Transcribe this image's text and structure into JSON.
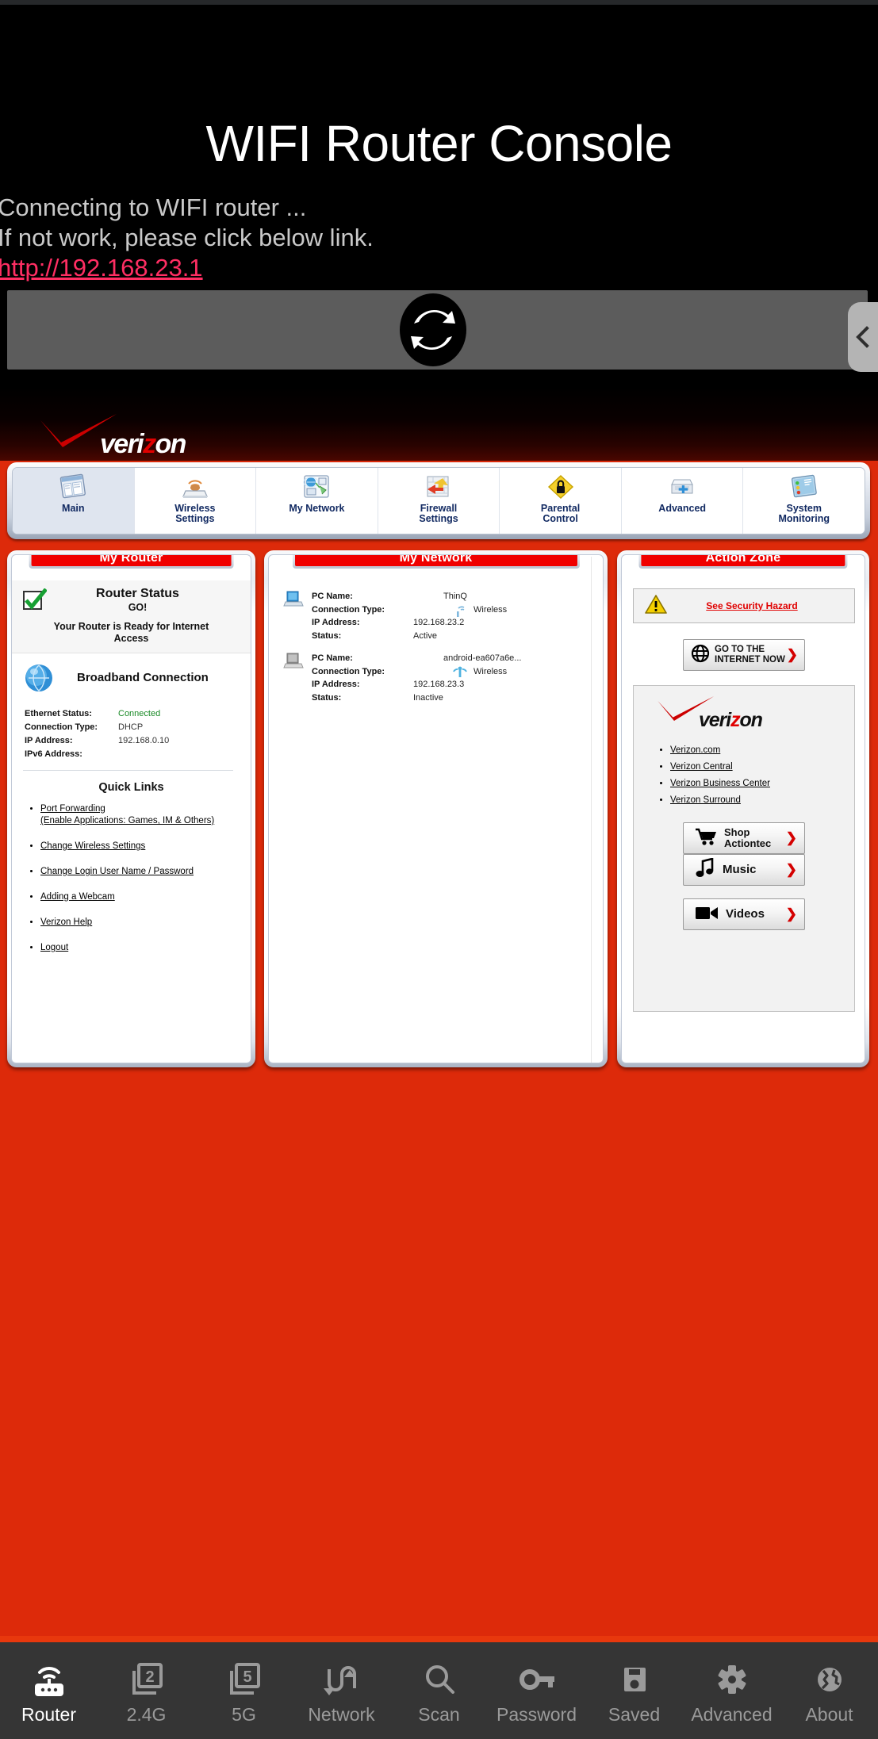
{
  "app": {
    "title": "WIFI Router Console",
    "connecting_text": "Connecting to WIFI router ...",
    "fallback_text": " If not work, please click below link.",
    "fallback_link": "http://192.168.23.1",
    "link_color": "#ff2e63",
    "accent_red": "#e8380d",
    "page_red": "#dd2a0a"
  },
  "refresh_bar": {
    "icon": "refresh-icon",
    "side_tab_icon": "chevron-left-icon"
  },
  "router_page": {
    "brand": {
      "word_ver": "veri",
      "word_z": "z",
      "word_on": "on"
    },
    "nav": [
      {
        "label_line1": "Main",
        "label_line2": "",
        "icon": "main-window-icon",
        "active": true
      },
      {
        "label_line1": "Wireless",
        "label_line2": "Settings",
        "icon": "wireless-router-icon",
        "active": false
      },
      {
        "label_line1": "My Network",
        "label_line2": "",
        "icon": "my-network-icon",
        "active": false
      },
      {
        "label_line1": "Firewall",
        "label_line2": "Settings",
        "icon": "firewall-icon",
        "active": false
      },
      {
        "label_line1": "Parental",
        "label_line2": "Control",
        "icon": "parental-lock-icon",
        "active": false
      },
      {
        "label_line1": "Advanced",
        "label_line2": "",
        "icon": "advanced-box-icon",
        "active": false
      },
      {
        "label_line1": "System",
        "label_line2": "Monitoring",
        "icon": "system-monitor-icon",
        "active": false
      }
    ],
    "my_router": {
      "title": "My Router",
      "status_heading": "Router Status",
      "status_go": "GO!",
      "status_ready": "Your Router is Ready for Internet Access",
      "broadband_heading": "Broadband Connection",
      "fields": [
        {
          "key": "Ethernet Status:",
          "value": "Connected",
          "ok": true
        },
        {
          "key": "Connection Type:",
          "value": "DHCP",
          "ok": false
        },
        {
          "key": "IP Address:",
          "value": "192.168.0.10",
          "ok": false
        },
        {
          "key": "IPv6 Address:",
          "value": "",
          "ok": false
        }
      ],
      "quick_links_heading": "Quick Links",
      "quick_links": [
        "Port Forwarding (Enable Applications: Games, IM & Others)",
        "Change Wireless Settings",
        "Change Login User Name / Password",
        "Adding a Webcam",
        "Verizon Help",
        "Logout"
      ]
    },
    "my_network": {
      "title": "My Network",
      "devices": [
        {
          "icon": "computer-active-icon",
          "pc_name_key": "PC Name:",
          "pc_name": "ThinQ",
          "conn_key": "Connection Type:",
          "conn": "Wireless",
          "ip_key": "IP Address:",
          "ip": "192.168.23.2",
          "status_key": "Status:",
          "status": "Active"
        },
        {
          "icon": "computer-inactive-icon",
          "pc_name_key": "PC Name:",
          "pc_name": "android-ea607a6e...",
          "conn_key": "Connection Type:",
          "conn": "Wireless",
          "ip_key": "IP Address:",
          "ip": "192.168.23.3",
          "status_key": "Status:",
          "status": "Inactive"
        }
      ]
    },
    "action_zone": {
      "title": "Action Zone",
      "security_hazard": "See Security Hazard",
      "go_internet_line1": "GO TO THE",
      "go_internet_line2": "INTERNET NOW",
      "links": [
        "Verizon.com",
        "Verizon Central",
        "Verizon Business Center",
        "Verizon Surround"
      ],
      "buttons": [
        {
          "line1": "Shop",
          "line2": "Actiontec",
          "icon": "cart-icon"
        },
        {
          "line1": "Music",
          "line2": "",
          "icon": "music-note-icon"
        },
        {
          "line1": "Videos",
          "line2": "",
          "icon": "video-camera-icon"
        }
      ]
    }
  },
  "bottom_nav": [
    {
      "label": "Router",
      "icon": "router-wifi-icon",
      "active": true
    },
    {
      "label": "2.4G",
      "icon": "band-2-icon",
      "active": false
    },
    {
      "label": "5G",
      "icon": "band-5-icon",
      "active": false
    },
    {
      "label": "Network",
      "icon": "transfer-icon",
      "active": false
    },
    {
      "label": "Scan",
      "icon": "search-icon",
      "active": false
    },
    {
      "label": "Password",
      "icon": "key-icon",
      "active": false
    },
    {
      "label": "Saved",
      "icon": "save-disk-icon",
      "active": false
    },
    {
      "label": "Advanced",
      "icon": "gear-icon",
      "active": false
    },
    {
      "label": "About",
      "icon": "globe-icon",
      "active": false
    }
  ]
}
